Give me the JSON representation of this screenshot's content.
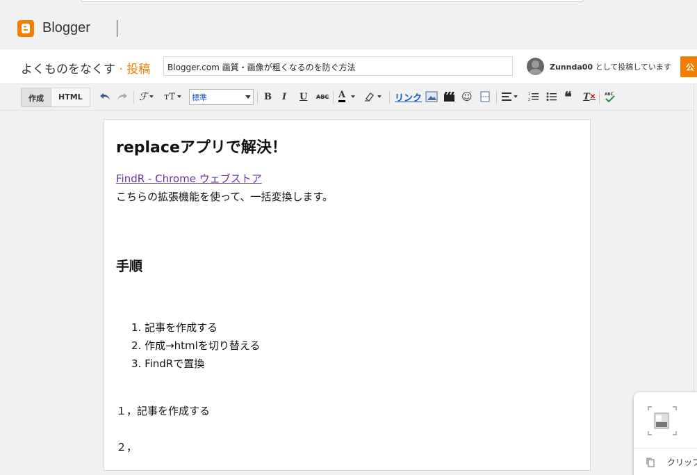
{
  "brand": {
    "name": "Blogger",
    "logo_icon": "blogger-logo-icon",
    "accent": "#f57d00"
  },
  "post_header": {
    "blog_name": "よくものをなくす",
    "separator": "·",
    "section": "投稿",
    "title_value": "Blogger.com 画質・画像が粗くなるのを防ぐ方法",
    "user": "Zunnda00",
    "posting_as_suffix": "として投稿しています",
    "publish_label": "公"
  },
  "toolbar": {
    "compose_label": "作成",
    "html_label": "HTML",
    "format_value": "標準",
    "link_label": "リンク",
    "icons": [
      "undo-icon",
      "redo-icon",
      "font-family-icon",
      "font-size-icon",
      "bold-icon",
      "italic-icon",
      "underline-icon",
      "strikethrough-icon",
      "text-color-icon",
      "highlight-icon",
      "link-icon",
      "image-icon",
      "video-icon",
      "emoji-icon",
      "jump-break-icon",
      "align-icon",
      "numbered-list-icon",
      "bulleted-list-icon",
      "quote-icon",
      "clear-format-icon",
      "spellcheck-icon"
    ]
  },
  "editor": {
    "heading": "replaceアプリで解決！",
    "link_text": "FindR - Chrome ウェブストア",
    "paragraph": "こちらの拡張機能を使って、一括変換します。",
    "subheading": "手順",
    "steps": [
      "1. 記事を作成する",
      "2. 作成→htmlを切り替える",
      "3. FindRで置換"
    ],
    "step_line_1": "１，記事を作成する",
    "step_line_2": "２，"
  },
  "floating_panel": {
    "clip_label": "クリップ"
  }
}
